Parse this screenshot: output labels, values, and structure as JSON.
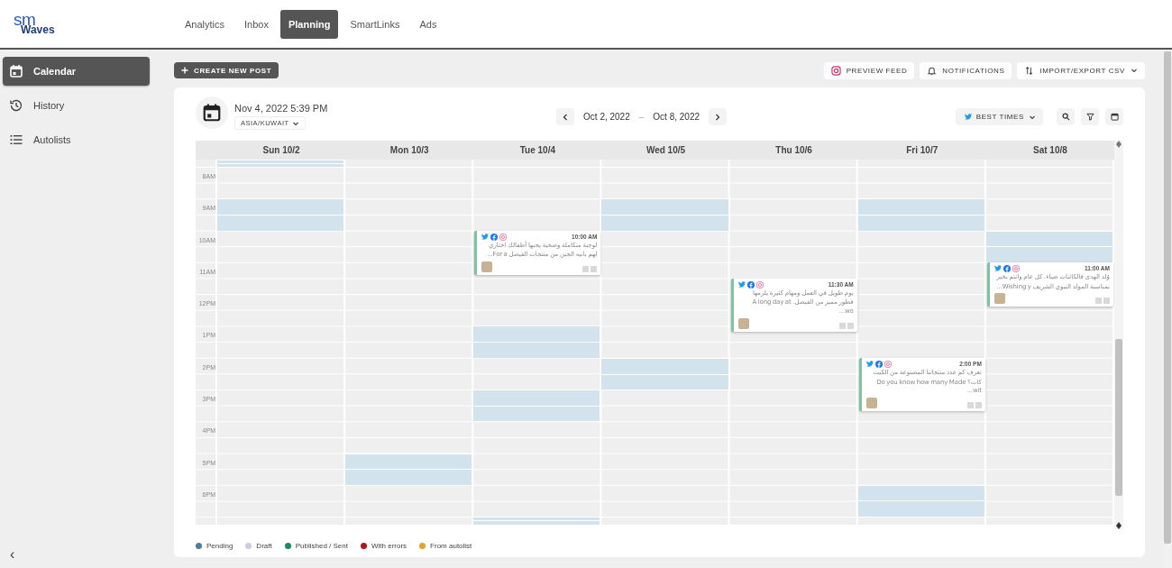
{
  "logo": {
    "top": "sm",
    "bottom": "Waves"
  },
  "nav": [
    {
      "label": "Analytics",
      "selected": false
    },
    {
      "label": "Inbox",
      "selected": false
    },
    {
      "label": "Planning",
      "selected": true
    },
    {
      "label": "SmartLinks",
      "selected": false
    },
    {
      "label": "Ads",
      "selected": false
    }
  ],
  "sidebar": {
    "items": [
      {
        "label": "Calendar",
        "kind": "calendar",
        "selected": true
      },
      {
        "label": "History",
        "kind": "history",
        "selected": false
      },
      {
        "label": "Autolists",
        "kind": "list",
        "selected": false
      }
    ],
    "collapse": "‹"
  },
  "toolbar": {
    "create_button": "CREATE NEW POST",
    "buttons": [
      {
        "label": "PREVIEW FEED",
        "kind": "instagram",
        "dropdown": false
      },
      {
        "label": "NOTIFICATIONS",
        "kind": "bell",
        "dropdown": false
      },
      {
        "label": "IMPORT/EXPORT CSV",
        "kind": "sort",
        "dropdown": true
      }
    ]
  },
  "calendar": {
    "now": "Nov 4, 2022 5:39 PM",
    "timezone": "ASIA/KUWAIT",
    "range_start": "Oct 2, 2022",
    "range_separator": "–",
    "range_end": "Oct 8, 2022",
    "best_times": "BEST TIMES",
    "days": [
      "Sun 10/2",
      "Mon 10/3",
      "Tue 10/4",
      "Wed 10/5",
      "Thu 10/6",
      "Fri 10/7",
      "Sat 10/8"
    ],
    "rows": [
      {
        "kind": "top",
        "cells": [
          {
            "best": true
          },
          {
            "best": false
          },
          {
            "best": false
          },
          {
            "best": false
          },
          {
            "best": false
          },
          {
            "best": false
          },
          {
            "best": false
          }
        ]
      },
      {
        "kind": "hour",
        "label": "8AM",
        "cells": [
          {
            "best": false
          },
          {
            "best": false
          },
          {
            "best": false
          },
          {
            "best": false
          },
          {
            "best": false
          },
          {
            "best": false
          },
          {
            "best": false
          }
        ]
      },
      {
        "kind": "hour",
        "label": "9AM",
        "cells": [
          {
            "best": true
          },
          {
            "best": false
          },
          {
            "best": false
          },
          {
            "best": true
          },
          {
            "best": false
          },
          {
            "best": true
          },
          {
            "best": false
          }
        ]
      },
      {
        "kind": "hour",
        "label": "10AM",
        "cells": [
          {
            "best": false
          },
          {
            "best": false
          },
          {
            "best": false,
            "posts": [
              {
                "networks": [
                  {
                    "kind": "twitter"
                  },
                  {
                    "kind": "facebook"
                  },
                  {
                    "kind": "instagram"
                  }
                ],
                "time": "10:00 AM",
                "lines": [
                  "لوجبة متكاملة وصحية يحبها أطفالك اختاري",
                  "لهم بانيه الجبن من منتجات الفيصل For a..."
                ],
                "half_past": false,
                "color": "#7cc4a4"
              }
            ]
          },
          {
            "best": false
          },
          {
            "best": false
          },
          {
            "best": false
          },
          {
            "best": true
          }
        ]
      },
      {
        "kind": "hour",
        "label": "11AM",
        "cells": [
          {
            "best": false
          },
          {
            "best": false
          },
          {
            "best": false
          },
          {
            "best": false
          },
          {
            "best": false,
            "posts": [
              {
                "networks": [
                  {
                    "kind": "twitter"
                  },
                  {
                    "kind": "facebook"
                  },
                  {
                    "kind": "instagram"
                  }
                ],
                "time": "11:30 AM",
                "lines": [
                  "يوم طويل في العمل ومهام كثيرة يلزمها",
                  "فطور مميز من الفيصل. A long day at wo..."
                ],
                "half_past": true,
                "color": "#7cc4a4"
              }
            ]
          },
          {
            "best": false
          },
          {
            "best": false,
            "posts": [
              {
                "networks": [
                  {
                    "kind": "twitter"
                  },
                  {
                    "kind": "facebook"
                  },
                  {
                    "kind": "instagram"
                  }
                ],
                "time": "11:00 AM",
                "lines": [
                  "وُلد الهدى فالكائنات ضياء. كل عام وانتم بخير",
                  "بمناسبة المولد النبوي الشريف Wishing y..."
                ],
                "half_past": false,
                "color": "#7cc4a4"
              }
            ]
          }
        ]
      },
      {
        "kind": "hour",
        "label": "12PM",
        "cells": [
          {
            "best": false
          },
          {
            "best": false
          },
          {
            "best": false
          },
          {
            "best": false
          },
          {
            "best": false
          },
          {
            "best": false
          },
          {
            "best": false
          }
        ]
      },
      {
        "kind": "hour",
        "label": "1PM",
        "cells": [
          {
            "best": false
          },
          {
            "best": false
          },
          {
            "best": true
          },
          {
            "best": false
          },
          {
            "best": false
          },
          {
            "best": false
          },
          {
            "best": false
          }
        ]
      },
      {
        "kind": "hour",
        "label": "2PM",
        "cells": [
          {
            "best": false
          },
          {
            "best": false
          },
          {
            "best": false
          },
          {
            "best": true
          },
          {
            "best": false
          },
          {
            "best": false,
            "posts": [
              {
                "networks": [
                  {
                    "kind": "twitter"
                  },
                  {
                    "kind": "facebook"
                  },
                  {
                    "kind": "instagram"
                  }
                ],
                "time": "2:00 PM",
                "lines": [
                  "تعرف كم عدد منتجاتنا المصنوعة من الكيت",
                  "كات؟ Do you know how many Made wit..."
                ],
                "half_past": false,
                "color": "#7cc4a4"
              }
            ]
          },
          {
            "best": false
          }
        ]
      },
      {
        "kind": "hour",
        "label": "3PM",
        "cells": [
          {
            "best": false
          },
          {
            "best": false
          },
          {
            "best": true
          },
          {
            "best": false
          },
          {
            "best": false
          },
          {
            "best": false
          },
          {
            "best": false
          }
        ]
      },
      {
        "kind": "hour",
        "label": "4PM",
        "cells": [
          {
            "best": false
          },
          {
            "best": false
          },
          {
            "best": false
          },
          {
            "best": false
          },
          {
            "best": false
          },
          {
            "best": false
          },
          {
            "best": false
          }
        ]
      },
      {
        "kind": "hour",
        "label": "5PM",
        "cells": [
          {
            "best": false
          },
          {
            "best": true
          },
          {
            "best": false
          },
          {
            "best": false
          },
          {
            "best": false
          },
          {
            "best": false
          },
          {
            "best": false
          }
        ]
      },
      {
        "kind": "hour",
        "label": "6PM",
        "cells": [
          {
            "best": false
          },
          {
            "best": false
          },
          {
            "best": false
          },
          {
            "best": false
          },
          {
            "best": false
          },
          {
            "best": true
          },
          {
            "best": false
          }
        ]
      },
      {
        "kind": "bottom",
        "cells": [
          {
            "best": false
          },
          {
            "best": false
          },
          {
            "best": true
          },
          {
            "best": false
          },
          {
            "best": false
          },
          {
            "best": false
          },
          {
            "best": false
          }
        ]
      }
    ]
  },
  "legend": [
    {
      "label": "Pending",
      "color": "#4a7fa0"
    },
    {
      "label": "Draft",
      "color": "#c9cfdc"
    },
    {
      "label": "Published / Sent",
      "color": "#1a8a6e"
    },
    {
      "label": "With errors",
      "color": "#b5121b"
    },
    {
      "label": "From autolist",
      "color": "#e8a326"
    }
  ]
}
